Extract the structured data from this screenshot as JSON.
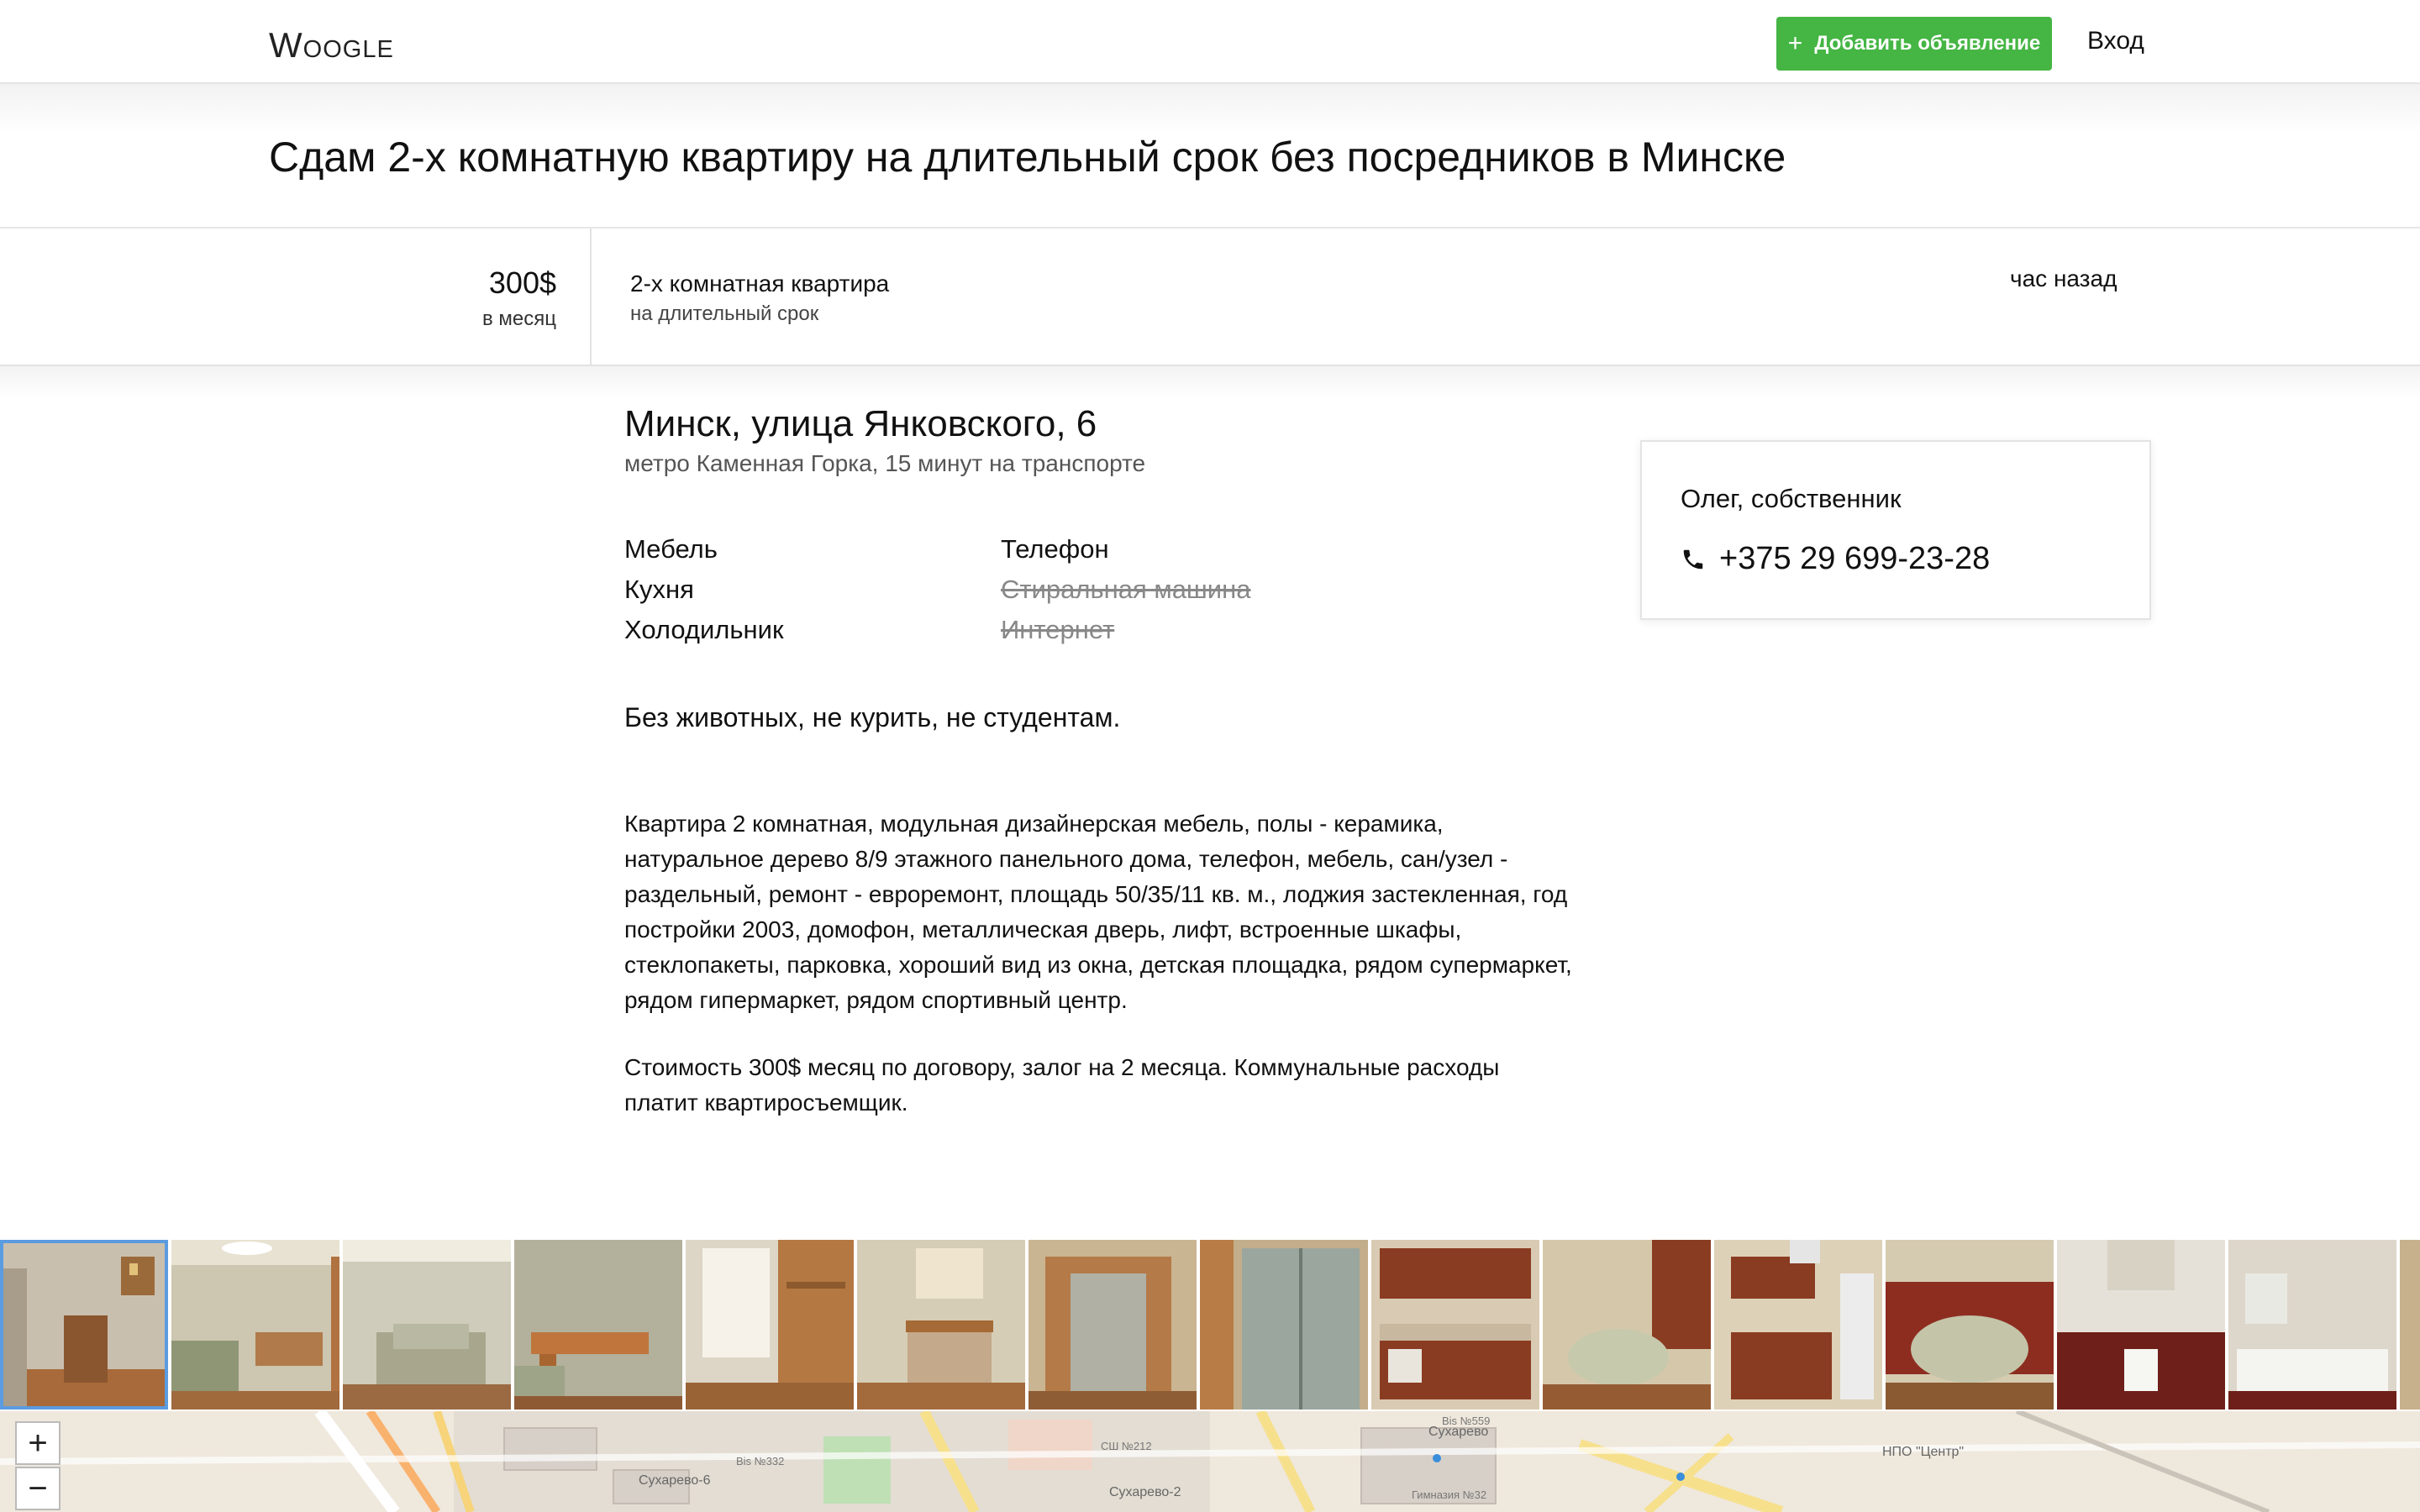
{
  "header": {
    "logo": "Woogle",
    "add_button_icon": "+",
    "add_button_label": "Добавить объявление",
    "login_label": "Вход",
    "accent_color": "#45b544"
  },
  "listing": {
    "title": "Сдам 2-х комнатную квартиру на длительный срок без посредников в Минске",
    "price": "300$",
    "price_period": "в месяц",
    "property_type": "2-х комнатная квартира",
    "rental_term": "на длительный срок",
    "posted": "час назад",
    "address": "Минск, улица Янковского, 6",
    "metro": "метро Каменная Горка, 15 минут на транспорте",
    "features": [
      {
        "label": "Мебель",
        "available": true
      },
      {
        "label": "Кухня",
        "available": true
      },
      {
        "label": "Холодильник",
        "available": true
      },
      {
        "label": "Телефон",
        "available": true
      },
      {
        "label": "Стиральная машина",
        "available": false
      },
      {
        "label": "Интернет",
        "available": false
      }
    ],
    "rules": "Без животных, не курить, не студентам.",
    "description": [
      "Квартира 2 комнатная, модульная дизайнерская мебель, полы - керамика, натуральное дерево 8/9 этажного панельного дома, телефон, мебель, сан/узел - раздельный, ремонт - евроремонт, площадь 50/35/11 кв. м., лоджия застекленная, год постройки 2003, домофон, металлическая дверь, лифт, встроенные шкафы, стеклопакеты, парковка, хороший вид из окна, детская площадка, рядом супермаркет, рядом гипермаркет, рядом спортивный центр.",
      "Стоимость 300$ месяц по договору, залог на 2 месяца. Коммунальные расходы платит квартиросъемщик."
    ]
  },
  "contact": {
    "owner": "Олег, собственник",
    "phone": "+375 29 699-23-28",
    "phone_icon": "phone-icon"
  },
  "gallery": {
    "photo_count": 15,
    "active_index": 0
  },
  "map": {
    "zoom_in_label": "+",
    "zoom_out_label": "−",
    "labels": [
      "Сухарево-6",
      "Сухарево-2",
      "Сухарево",
      "НПО \"Центр\"",
      "СШ №212",
      "Гимназия №32",
      "Bis №332",
      "Bis №559"
    ]
  }
}
